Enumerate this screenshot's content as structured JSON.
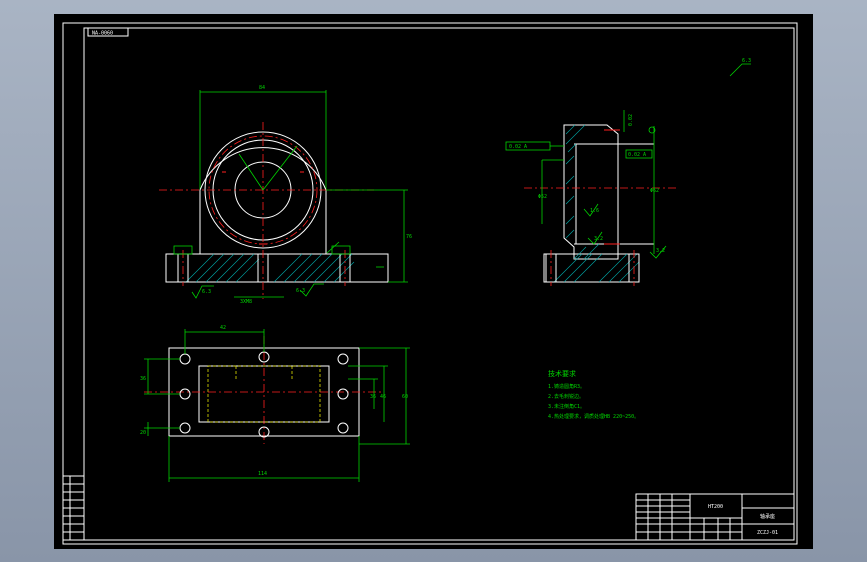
{
  "title_box": {
    "label": "NA-0060"
  },
  "roughness_corner": "6.3",
  "front_view": {
    "dim_top": "84",
    "dim_height": "76",
    "roughness": "6.3",
    "dim_bottom": "3XM8"
  },
  "side_view": {
    "tol_top": "0.02",
    "tol_left": "0.02 A",
    "tol_mid": "0.02 A",
    "dim_vert": "Φ62",
    "dim_left": "Φ52",
    "rough_in1": "1.6",
    "rough_in2": "3.2",
    "rough_low": "3.2"
  },
  "top_view": {
    "dim_top": "42",
    "dim_left": "36",
    "dim_left2": "20",
    "dim_right1": "36",
    "dim_right2": "46",
    "dim_right3": "60",
    "dim_bottom": "114"
  },
  "notes": {
    "heading": "技术要求",
    "lines": [
      "1.铸造圆角R3。",
      "2.去毛刺锐边。",
      "3.未注倒角C1。",
      "4.热处理要求，调质处理HB 220~250。"
    ]
  },
  "title_block": {
    "mid_label": "HT200",
    "name": "轴承座",
    "code": "ZCZJ-01"
  }
}
